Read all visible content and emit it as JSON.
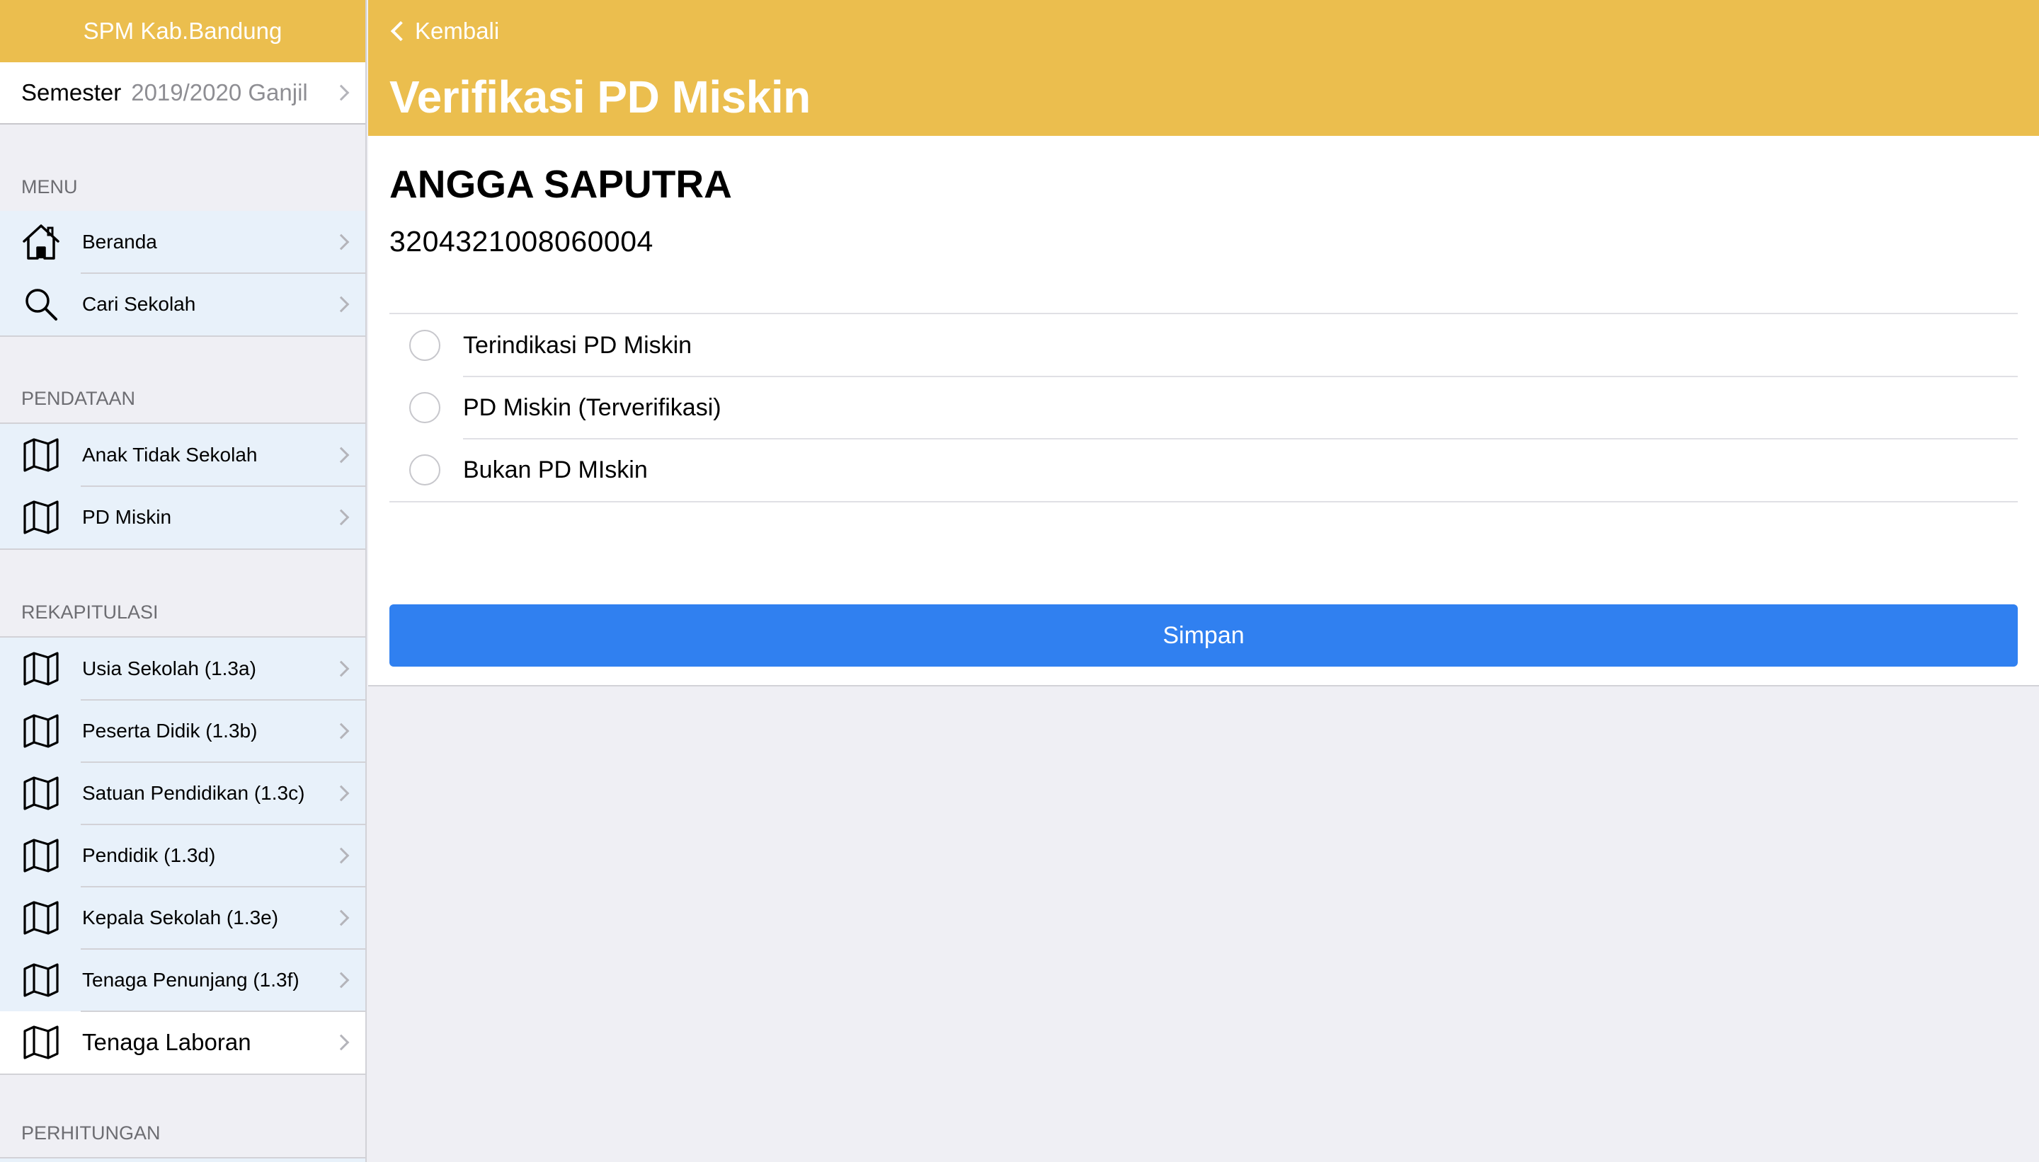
{
  "sidebar": {
    "app_title": "SPM Kab.Bandung",
    "semester": {
      "label": "Semester",
      "value": "2019/2020 Ganjil"
    },
    "sections": [
      {
        "header": "MENU",
        "items": [
          {
            "label": "Beranda",
            "icon": "home-icon"
          },
          {
            "label": "Cari Sekolah",
            "icon": "search-icon"
          }
        ]
      },
      {
        "header": "PENDATAAN",
        "items": [
          {
            "label": "Anak Tidak Sekolah",
            "icon": "map-icon"
          },
          {
            "label": "PD Miskin",
            "icon": "map-icon"
          }
        ]
      },
      {
        "header": "REKAPITULASI",
        "items": [
          {
            "label": "Usia Sekolah (1.3a)",
            "icon": "map-icon"
          },
          {
            "label": "Peserta Didik (1.3b)",
            "icon": "map-icon"
          },
          {
            "label": "Satuan Pendidikan (1.3c)",
            "icon": "map-icon"
          },
          {
            "label": "Pendidik (1.3d)",
            "icon": "map-icon"
          },
          {
            "label": "Kepala Sekolah (1.3e)",
            "icon": "map-icon"
          },
          {
            "label": "Tenaga Penunjang (1.3f)",
            "icon": "map-icon"
          },
          {
            "label": "Tenaga Laboran",
            "icon": "map-icon",
            "selected": true
          }
        ]
      },
      {
        "header": "PERHITUNGAN",
        "items": []
      }
    ]
  },
  "nav": {
    "back_label": "Kembali",
    "title": "Verifikasi PD Miskin"
  },
  "student": {
    "name": "ANGGA SAPUTRA",
    "nik": "3204321008060004"
  },
  "options": [
    {
      "label": "Terindikasi PD Miskin",
      "selected": false
    },
    {
      "label": "PD Miskin (Terverifikasi)",
      "selected": false
    },
    {
      "label": "Bukan PD MIskin",
      "selected": false
    }
  ],
  "save_label": "Simpan",
  "colors": {
    "header": "#ebbe4e",
    "primary_button": "#3080f0",
    "menu_bg": "#e8f1fa",
    "page_bg": "#efeff4"
  }
}
